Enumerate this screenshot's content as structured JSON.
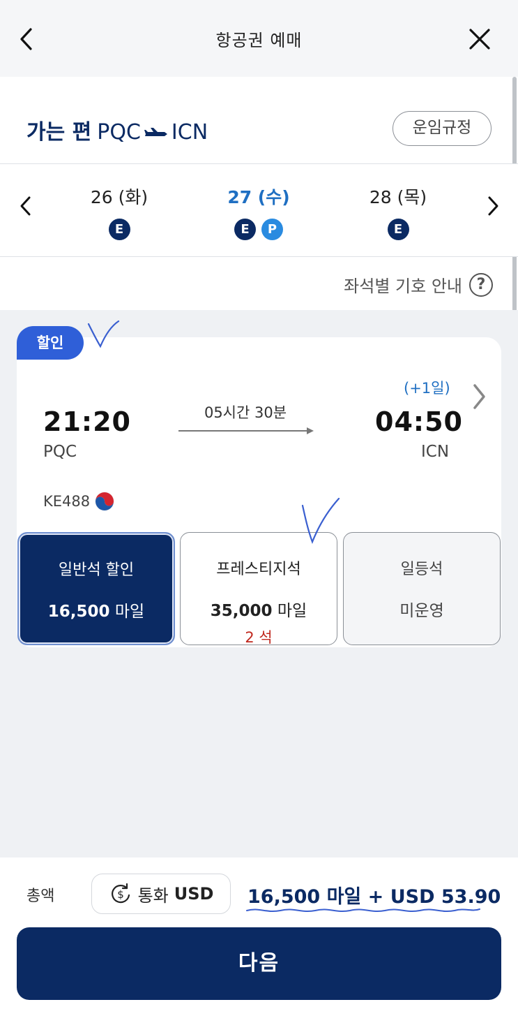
{
  "header": {
    "title": "항공권 예매",
    "back_icon": "chevron-left-icon",
    "close_icon": "close-icon"
  },
  "route": {
    "direction": "가는 편",
    "origin": "PQC",
    "destination": "ICN",
    "fare_rules_label": "운임규정"
  },
  "dates": [
    {
      "label": "26 (화)",
      "badges": [
        "E"
      ],
      "active": false
    },
    {
      "label": "27 (수)",
      "badges": [
        "E",
        "P"
      ],
      "active": true
    },
    {
      "label": "28 (목)",
      "badges": [
        "E"
      ],
      "active": false
    }
  ],
  "seat_guide": {
    "label": "좌석별 기호 안내",
    "icon": "question-icon"
  },
  "flight": {
    "tag": "할인",
    "departure_time": "21:20",
    "departure_code": "PQC",
    "arrival_time": "04:50",
    "arrival_code": "ICN",
    "day_offset": "(+1일)",
    "duration": "05시간 30분",
    "flight_number": "KE488"
  },
  "fares": [
    {
      "name": "일반석 할인",
      "price": "16,500",
      "unit": "마일",
      "seats": "",
      "selected": true
    },
    {
      "name": "프레스티지석",
      "price": "35,000",
      "unit": "마일",
      "seats": "2 석",
      "selected": false
    },
    {
      "name": "일등석",
      "price": "",
      "unit": "미운영",
      "seats": "",
      "selected": false
    }
  ],
  "footer": {
    "total_label": "총액",
    "currency_prefix": "통화",
    "currency_code": "USD",
    "total_amount": "16,500 마일 + USD 53.90",
    "next_label": "다음"
  },
  "colors": {
    "navy": "#0b2a63",
    "accent_blue": "#1f6fc2",
    "tag_blue": "#2f5fd8",
    "prestige_badge": "#2a8be0",
    "seat_red": "#c0281e",
    "annotation_ink": "#3a5fd0"
  }
}
